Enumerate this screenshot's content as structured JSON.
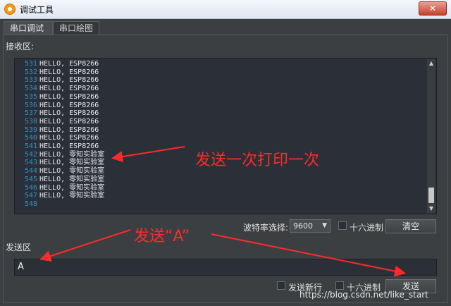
{
  "window": {
    "title": "调试工具",
    "close_symbol": "✕"
  },
  "tabs": [
    {
      "label": "串口调试"
    },
    {
      "label": "串口绘图"
    }
  ],
  "receive": {
    "label": "接收区:",
    "lines": [
      {
        "n": "531",
        "text": "HELLO, ESP8266"
      },
      {
        "n": "532",
        "text": "HELLO, ESP8266"
      },
      {
        "n": "533",
        "text": "HELLO, ESP8266"
      },
      {
        "n": "534",
        "text": "HELLO, ESP8266"
      },
      {
        "n": "535",
        "text": "HELLO, ESP8266"
      },
      {
        "n": "536",
        "text": "HELLO, ESP8266"
      },
      {
        "n": "537",
        "text": "HELLO, ESP8266"
      },
      {
        "n": "538",
        "text": "HELLO, ESP8266"
      },
      {
        "n": "539",
        "text": "HELLO, ESP8266"
      },
      {
        "n": "540",
        "text": "HELLO, ESP8266"
      },
      {
        "n": "541",
        "text": "HELLO, ESP8266"
      },
      {
        "n": "542",
        "text": "HELLO, 零知实验室"
      },
      {
        "n": "543",
        "text": "HELLO, 零知实验室"
      },
      {
        "n": "544",
        "text": "HELLO, 零知实验室"
      },
      {
        "n": "545",
        "text": "HELLO, 零知实验室"
      },
      {
        "n": "546",
        "text": "HELLO, 零知实验室"
      },
      {
        "n": "547",
        "text": "HELLO, 零知实验室"
      },
      {
        "n": "548",
        "text": ""
      }
    ],
    "baud_label": "波特率选择:",
    "baud_value": "9600",
    "hex_label": "十六进制",
    "clear_label": "清空"
  },
  "send": {
    "label": "发送区",
    "input_value": "A",
    "newline_label": "发送新行",
    "hex_label": "十六进制",
    "send_label": "发送"
  },
  "annotations": {
    "receive_note": "发送一次打印一次",
    "send_note": "发送“A”"
  },
  "watermark": "https://blog.csdn.net/like_start",
  "colors": {
    "annotation": "#ff2a2a",
    "line_number": "#2e93c8",
    "background": "#3c3f41"
  }
}
